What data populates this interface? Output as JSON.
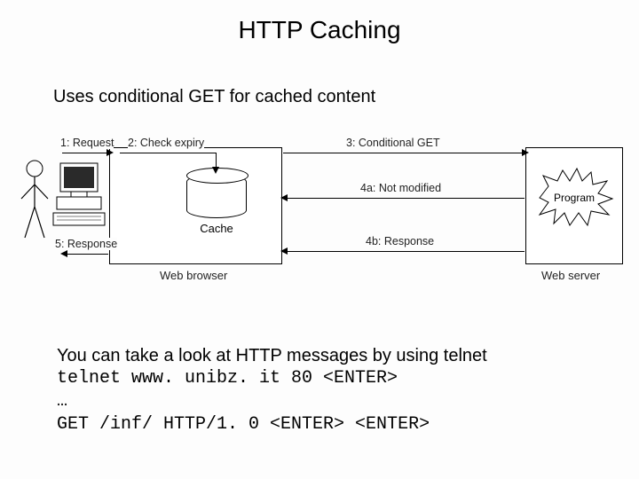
{
  "title": "HTTP Caching",
  "subtitle": "Uses conditional GET for cached content",
  "diagram": {
    "browser_label": "Web browser",
    "server_label": "Web server",
    "cache_label": "Cache",
    "program_label": "Program",
    "arrows": {
      "a1": "1: Request",
      "a2": "2: Check expiry",
      "a3": "3: Conditional GET",
      "a4a": "4a: Not modified",
      "a4b": "4b: Response",
      "a5": "5: Response"
    }
  },
  "footer": {
    "line1": "You can take a look at HTTP messages by using telnet",
    "line2": "telnet www. unibz. it 80 <ENTER>",
    "line3": "…",
    "line4": "GET /inf/ HTTP/1. 0 <ENTER> <ENTER>"
  }
}
